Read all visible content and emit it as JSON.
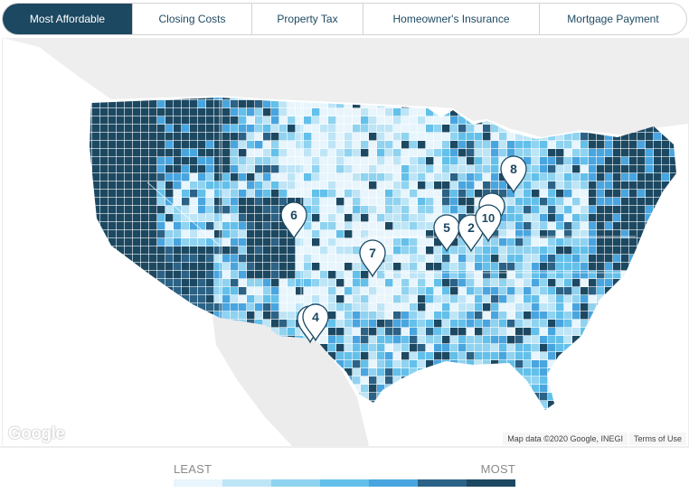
{
  "tabs": [
    {
      "label": "Most Affordable",
      "active": true
    },
    {
      "label": "Closing Costs",
      "active": false
    },
    {
      "label": "Property Tax",
      "active": false
    },
    {
      "label": "Homeowner's Insurance",
      "active": false
    },
    {
      "label": "Mortgage Payment",
      "active": false
    }
  ],
  "map": {
    "provider_logo": "Google",
    "attribution": "Map data ©2020 Google, INEGI",
    "terms_link": "Terms of Use",
    "region": "Contiguous United States (county choropleth)",
    "markers": [
      {
        "rank": "6",
        "location": "Colorado (Denver area)"
      },
      {
        "rank": "7",
        "location": "Kansas (Wichita area)"
      },
      {
        "rank": "5",
        "location": "Illinois (Springfield area)"
      },
      {
        "rank": "2",
        "location": "Indiana (Indianapolis area)"
      },
      {
        "rank": "",
        "location": "Northern Indiana (stacked)"
      },
      {
        "rank": "10",
        "location": "Indiana/Ohio (Fort Wayne area)"
      },
      {
        "rank": "8",
        "location": "Michigan (Lansing area)"
      },
      {
        "rank": "",
        "location": "New Mexico (stacked)"
      },
      {
        "rank": "4",
        "location": "New Mexico/Texas (El Paso area)"
      }
    ]
  },
  "legend": {
    "low_label": "LEAST",
    "high_label": "MOST",
    "colors": [
      "#e8f5fc",
      "#bee5f6",
      "#8fd3f0",
      "#63c0ea",
      "#49a5df",
      "#2b6286",
      "#1c4861"
    ]
  },
  "colors": {
    "accent": "#1c4861",
    "tab_border": "#d2d2d2",
    "land_background": "#efefef",
    "water": "#ffffff"
  }
}
